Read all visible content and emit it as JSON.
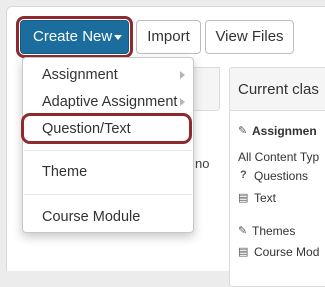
{
  "toolbar": {
    "create_new_label": "Create New",
    "import_label": "Import",
    "view_files_label": "View Files"
  },
  "dropdown": {
    "items": [
      {
        "label": "Assignment",
        "has_submenu": true
      },
      {
        "label": "Adaptive Assignment",
        "has_submenu": true
      },
      {
        "label": "Question/Text",
        "has_submenu": false
      },
      {
        "label": "Theme",
        "has_submenu": false
      },
      {
        "label": "Course Module",
        "has_submenu": false
      }
    ]
  },
  "left_panel": {
    "fragment": "no"
  },
  "right_panel": {
    "title": "Current clas",
    "assignments_label": "Assignmen",
    "all_content_label": "All Content Typ",
    "questions_label": "Questions",
    "text_label": "Text",
    "themes_label": "Themes",
    "course_module_label": "Course Mod"
  },
  "colors": {
    "primary_button": "#1a6d9c",
    "highlight_outline": "#8e2a2e"
  }
}
